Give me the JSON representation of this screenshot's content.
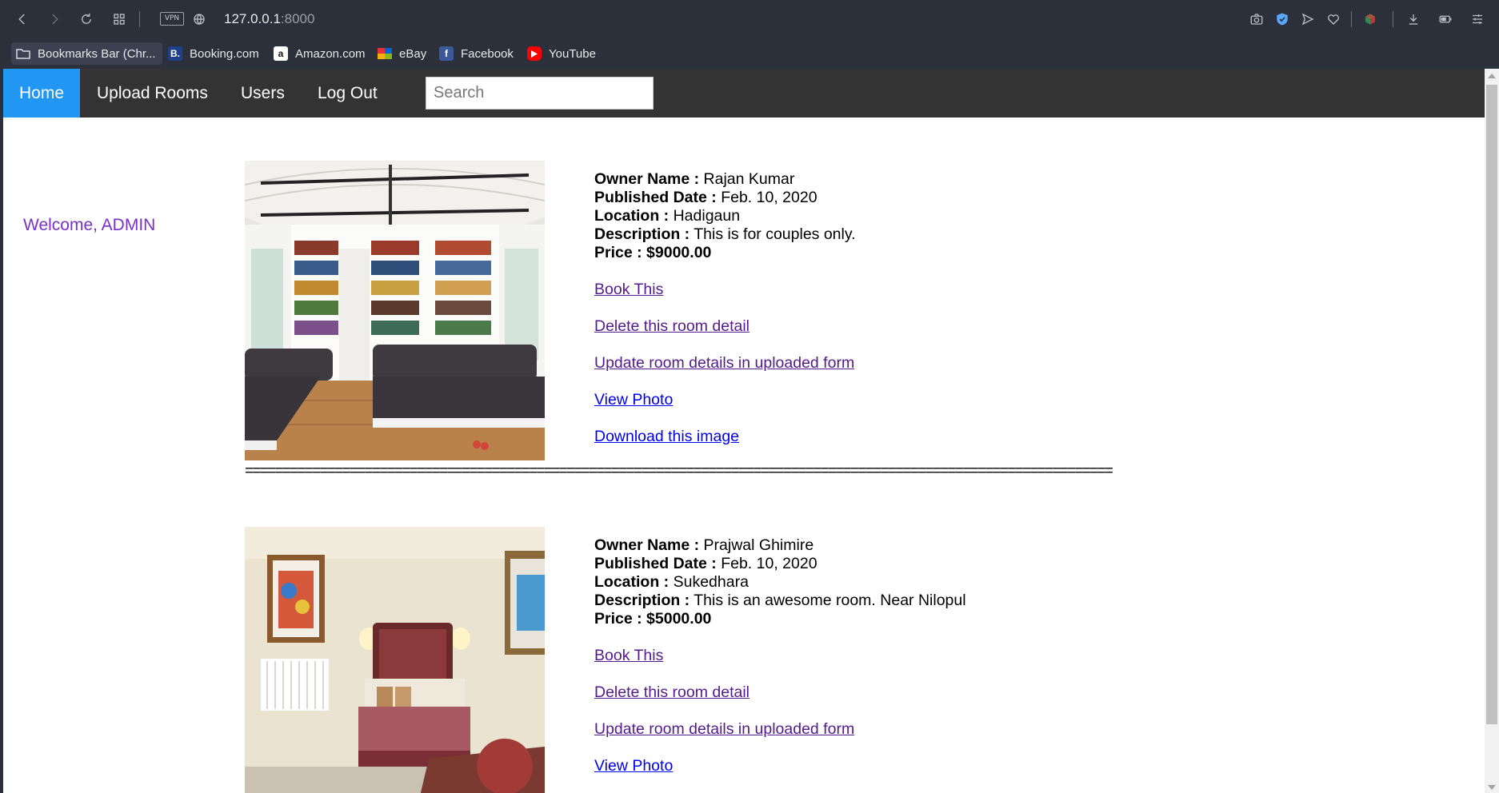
{
  "browser": {
    "url_host": "127.0.0.1",
    "url_port": ":8000",
    "vpn_label": "VPN",
    "bookmarks": [
      {
        "label": "Bookmarks Bar (Chr...",
        "icon": "folder-icon"
      },
      {
        "label": "Booking.com",
        "icon": "booking-icon"
      },
      {
        "label": "Amazon.com",
        "icon": "amazon-icon"
      },
      {
        "label": "eBay",
        "icon": "ebay-icon"
      },
      {
        "label": "Facebook",
        "icon": "facebook-icon"
      },
      {
        "label": "YouTube",
        "icon": "youtube-icon"
      }
    ]
  },
  "nav": {
    "home": "Home",
    "upload": "Upload Rooms",
    "users": "Users",
    "logout": "Log Out",
    "search_placeholder": "Search",
    "active_color": "#2196f3"
  },
  "sidebar": {
    "welcome": "Welcome, ADMIN"
  },
  "labels": {
    "owner": "Owner Name :",
    "published": "Published Date :",
    "location": "Location :",
    "description": "Description :",
    "price": "Price :"
  },
  "rooms": [
    {
      "owner": "Rajan Kumar",
      "published": "Feb. 10, 2020",
      "location": "Hadigaun",
      "description": "This is for couples only.",
      "price": "$9000.00",
      "links": {
        "book": "Book This",
        "delete": "Delete this room detail",
        "update": "Update room details in uploaded form",
        "view": "View Photo",
        "download": "Download this image"
      }
    },
    {
      "owner": "Prajwal Ghimire",
      "published": "Feb. 10, 2020",
      "location": "Sukedhara",
      "description": "This is an awesome room. Near Nilopul",
      "price": "$5000.00",
      "links": {
        "book": "Book This",
        "delete": "Delete this room detail",
        "update": "Update room details in uploaded form",
        "view": "View Photo"
      }
    }
  ],
  "divider": "===================================================================================================================="
}
